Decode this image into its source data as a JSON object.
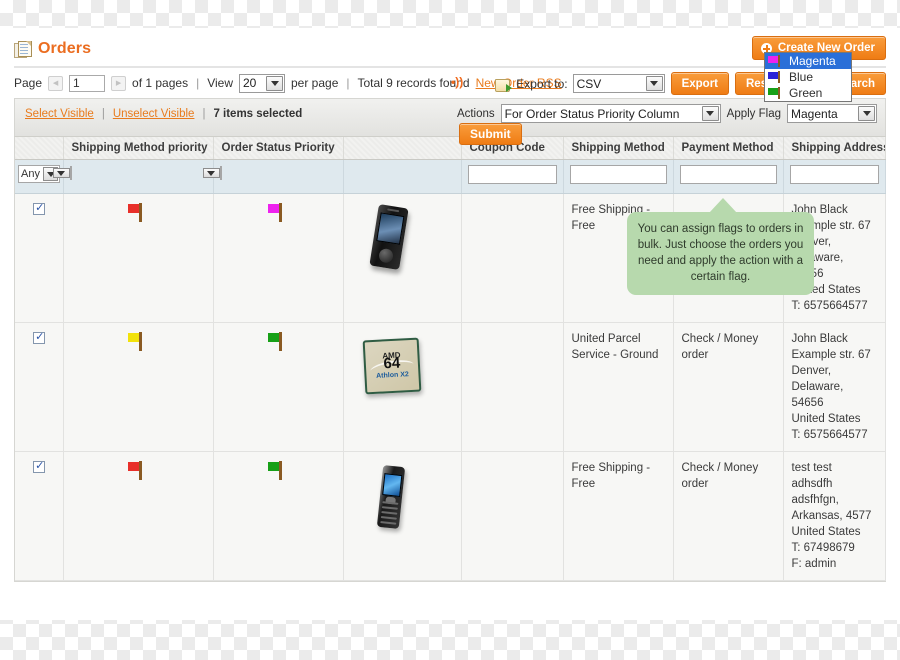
{
  "header": {
    "title": "Orders",
    "create_button": "Create New Order"
  },
  "pager": {
    "page_label": "Page",
    "page_value": "1",
    "of_pages": "of 1 pages",
    "view_label": "View",
    "view_value": "20",
    "per_page": "per page",
    "total_records": "Total 9 records found",
    "rss_link": "New Order RSS",
    "export_label": "Export to:",
    "export_format": "CSV",
    "export_button": "Export",
    "reset_filter_button": "Reset Filter",
    "search_button": "Search"
  },
  "massaction": {
    "select_visible": "Select Visible",
    "unselect_visible": "Unselect Visible",
    "items_selected": "7 items selected",
    "actions_label": "Actions",
    "actions_value": "For Order Status Priority Column",
    "apply_flag_label": "Apply Flag",
    "apply_flag_value": "Magenta",
    "submit_button": "Submit",
    "flag_options": [
      {
        "label": "Magenta",
        "color": "#ee22ee",
        "selected": true
      },
      {
        "label": "Blue",
        "color": "#2a22d8",
        "selected": false
      },
      {
        "label": "Green",
        "color": "#17a017",
        "selected": false
      }
    ]
  },
  "grid": {
    "columns": [
      {
        "label": ""
      },
      {
        "label": "Shipping Method priority"
      },
      {
        "label": "Order Status Priority"
      },
      {
        "label": ""
      },
      {
        "label": "Coupon Code"
      },
      {
        "label": "Shipping Method"
      },
      {
        "label": "Payment Method"
      },
      {
        "label": "Shipping Address"
      }
    ],
    "filters": {
      "any_select": "Any",
      "shipping_priority": "",
      "order_status_priority": "",
      "coupon_code": "",
      "shipping_method": "",
      "payment_method": "",
      "shipping_address": ""
    },
    "rows": [
      {
        "checked": true,
        "shipping_priority_flag": "#e8302a",
        "order_status_flag": "#ee22ee",
        "product": "smartphone-black",
        "coupon_code": "",
        "shipping_method": "Free Shipping - Free",
        "payment_method": "",
        "shipping_address": "John Black\nExample str. 67\nDenver, Delaware, 54656\nUnited States\nT: 6575664577"
      },
      {
        "checked": true,
        "shipping_priority_flag": "#f2e20a",
        "order_status_flag": "#17a017",
        "product": "amd-cpu",
        "coupon_code": "",
        "shipping_method": "United Parcel Service - Ground",
        "payment_method": "Check / Money order",
        "shipping_address": "John Black\nExample str. 67\nDenver, Delaware, 54656\nUnited States\nT: 6575664577"
      },
      {
        "checked": true,
        "shipping_priority_flag": "#e8302a",
        "order_status_flag": "#17a017",
        "product": "candybar-phone",
        "coupon_code": "",
        "shipping_method": "Free Shipping - Free",
        "payment_method": "Check / Money order",
        "shipping_address": "test test\nadhsdfh\nadsfhfgn,\nArkansas, 4577\nUnited States\nT: 67498679\nF: admin"
      }
    ]
  },
  "tooltip": {
    "text": "You can assign flags to orders in bulk. Just choose the orders you need and apply the action with a certain flag."
  },
  "product_labels": {
    "amd_brand": "AMD",
    "amd_number": "64",
    "amd_sub": "Athlon X2"
  }
}
